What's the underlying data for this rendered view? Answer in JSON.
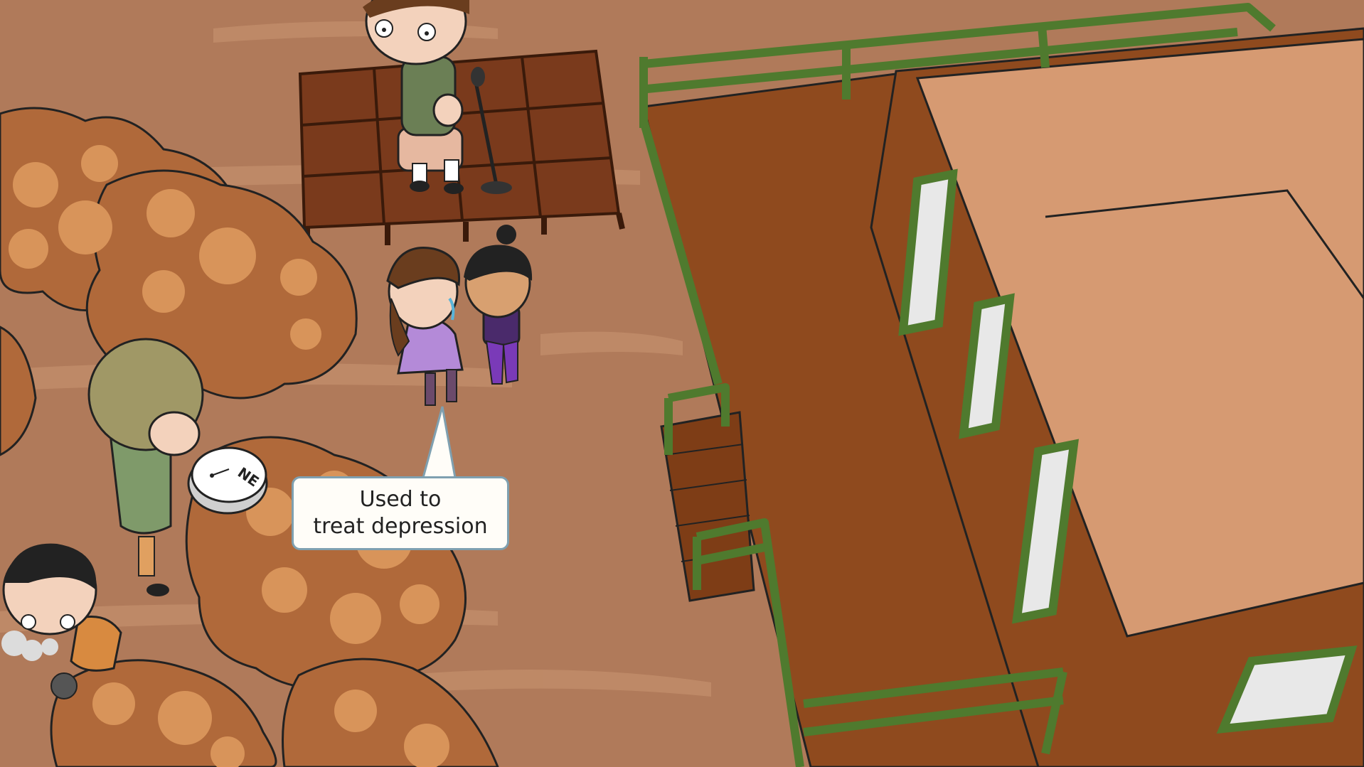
{
  "scene": {
    "caption": {
      "line1": "Used to",
      "line2": "treat depression"
    },
    "coin_label": "NE",
    "colors": {
      "ground": "#b07a5a",
      "ground_light": "#c89a7a",
      "building_wall": "#8f4a1e",
      "building_roof": "#d69a72",
      "railing": "#4f7a2e",
      "stage": "#7a3a1c",
      "tree": "#b0693a",
      "tree_spot": "#d8945a",
      "caption_border": "#7fa0b0"
    }
  }
}
